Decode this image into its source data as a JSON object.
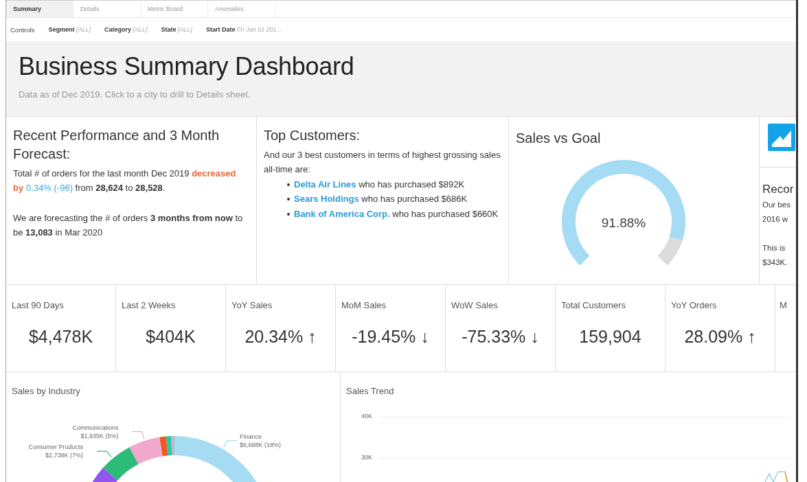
{
  "tabs": [
    {
      "label": "Summary",
      "selected": true
    },
    {
      "label": "Details",
      "selected": false
    },
    {
      "label": "Metric Board",
      "selected": false
    },
    {
      "label": "Anomalies",
      "selected": false
    }
  ],
  "controls": {
    "label": "Controls",
    "filters": [
      {
        "name": "Segment",
        "value": "[ALL]"
      },
      {
        "name": "Category",
        "value": "[ALL]"
      },
      {
        "name": "State",
        "value": "[ALL]"
      },
      {
        "name": "Start Date",
        "value": "Fri Jan 01 201..."
      }
    ]
  },
  "header": {
    "title": "Business Summary Dashboard",
    "subtitle": "Data as of Dec 2019. Click to a city to drill to Details sheet."
  },
  "performance": {
    "title": "Recent Performance and 3 Month Forecast:",
    "paragraphs": [
      [
        {
          "kind": "plain",
          "text": "Total # of orders for the last month Dec 2019 "
        },
        {
          "kind": "down",
          "text": "decreased by"
        },
        {
          "kind": "accent",
          "text": "0.34% (-96)"
        },
        {
          "kind": "plain",
          "text": " from "
        },
        {
          "kind": "bold",
          "text": "28,624"
        },
        {
          "kind": "plain",
          "text": " to "
        },
        {
          "kind": "bold",
          "text": "28,528"
        },
        {
          "kind": "plain",
          "text": "."
        }
      ],
      [
        {
          "kind": "plain",
          "text": "We are forecasting the # of orders "
        },
        {
          "kind": "bold",
          "text": "3 months from now"
        },
        {
          "kind": "plain",
          "text": " to be "
        },
        {
          "kind": "bold",
          "text": "13,083"
        },
        {
          "kind": "plain",
          "text": " in Mar 2020"
        }
      ]
    ]
  },
  "top_customers": {
    "title": "Top Customers:",
    "intro": "And our 3 best customers in terms of highest grossing sales all-time are:",
    "items": [
      {
        "name": "Delta Air Lines",
        "text": "who has purchased $892K"
      },
      {
        "name": "Sears Holdings",
        "text": "who has purchased $686K"
      },
      {
        "name": "Bank of America Corp.",
        "text": "who has purchased $660K"
      }
    ]
  },
  "sales_vs_goal": {
    "title": "Sales vs Goal",
    "reading": "91.88%"
  },
  "record_card": {
    "title": "Recor",
    "lines": [
      "Our bes",
      "2016 w"
    ],
    "lines_2": [
      "This is",
      "$343K."
    ]
  },
  "kpis": [
    {
      "label": "Last 90 Days",
      "value": "$4,478K"
    },
    {
      "label": "Last 2 Weeks",
      "value": "$404K"
    },
    {
      "label": "YoY Sales",
      "value": "20.34% ↑"
    },
    {
      "label": "MoM Sales",
      "value": "-19.45% ↓"
    },
    {
      "label": "WoW Sales",
      "value": "-75.33% ↓"
    },
    {
      "label": "Total Customers",
      "value": "159,904"
    },
    {
      "label": "YoY Orders",
      "value": "28.09% ↑"
    },
    {
      "label": "M"
    }
  ],
  "sales_by_industry": {
    "title": "Sales by Industry",
    "slices": [
      {
        "kind": "labeled",
        "label": "Finance",
        "value": "$6,688K (18%)",
        "color": "#a6dcf3"
      },
      {
        "kind": "plain",
        "color": "#b8b8c8"
      },
      {
        "kind": "plain",
        "color": "#2ac9a8"
      },
      {
        "kind": "plain",
        "color": "#f05a22"
      },
      {
        "kind": "labeled",
        "label": "Communications",
        "value": "$1,935K (5%)",
        "color": "#f0a8cc"
      },
      {
        "kind": "labeled",
        "label": "Consumer Products",
        "value": "$2,738K (7%)",
        "color": "#2dbb78"
      },
      {
        "kind": "plain",
        "color": "#9155f0"
      }
    ]
  },
  "sales_trend": {
    "title": "Sales Trend",
    "y_axis_labels": [
      "40K",
      "30K"
    ]
  }
}
